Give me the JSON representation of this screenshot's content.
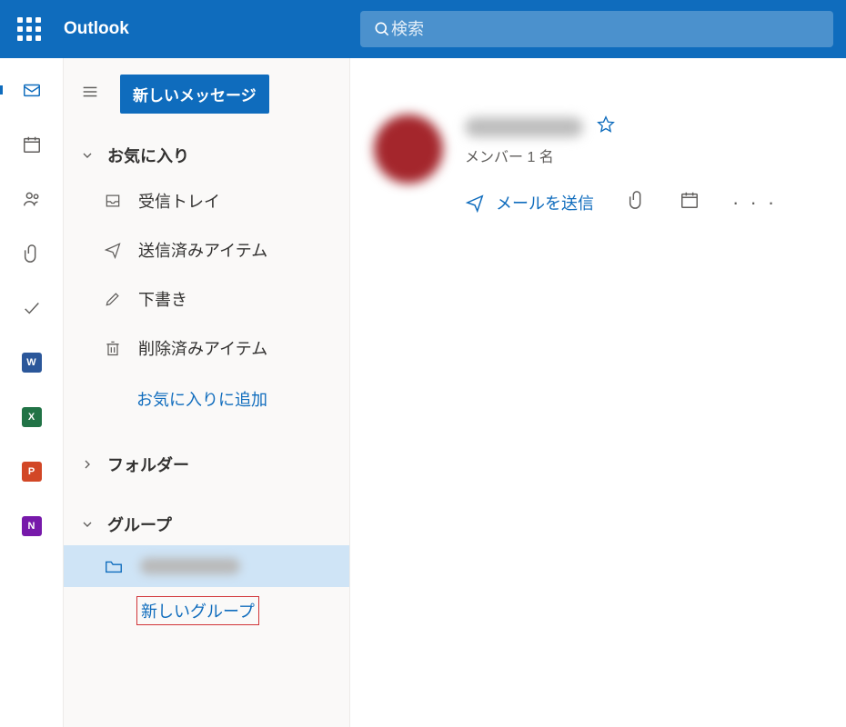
{
  "header": {
    "app_title": "Outlook",
    "search_placeholder": "検索"
  },
  "toolbar": {
    "new_message": "新しいメッセージ"
  },
  "favorites": {
    "header": "お気に入り",
    "items": {
      "inbox": "受信トレイ",
      "sent": "送信済みアイテム",
      "drafts": "下書き",
      "deleted": "削除済みアイテム"
    },
    "add_link": "お気に入りに追加"
  },
  "folders": {
    "header": "フォルダー"
  },
  "groups": {
    "header": "グループ",
    "new_group": "新しいグループ"
  },
  "group_panel": {
    "members": "メンバー 1 名",
    "send_mail": "メールを送信"
  },
  "rail_apps": {
    "word": "W",
    "excel": "X",
    "powerpoint": "P",
    "onenote": "N"
  }
}
